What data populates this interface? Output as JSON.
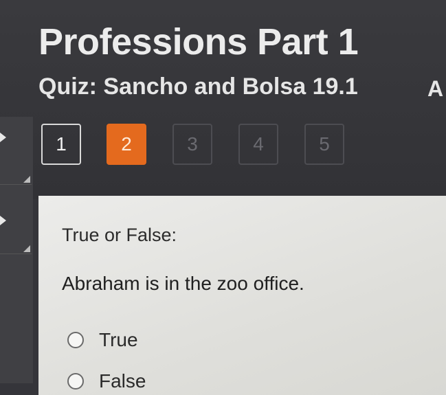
{
  "page": {
    "title": "Professions Part 1",
    "quiz_title": "Quiz: Sancho and Bolsa 19.1",
    "extra_letter": "A"
  },
  "question_nav": [
    {
      "label": "1",
      "state": "answered"
    },
    {
      "label": "2",
      "state": "current"
    },
    {
      "label": "3",
      "state": "pending"
    },
    {
      "label": "4",
      "state": "pending"
    },
    {
      "label": "5",
      "state": "pending"
    }
  ],
  "question": {
    "prompt": "True or False:",
    "statement": "Abraham is in the zoo office.",
    "options": [
      "True",
      "False"
    ]
  },
  "colors": {
    "current_question": "#e46a1e",
    "background": "#35353a",
    "card": "#e6e6e3"
  },
  "icons": {
    "sidebar_toggle": "chevron-right-icon"
  }
}
